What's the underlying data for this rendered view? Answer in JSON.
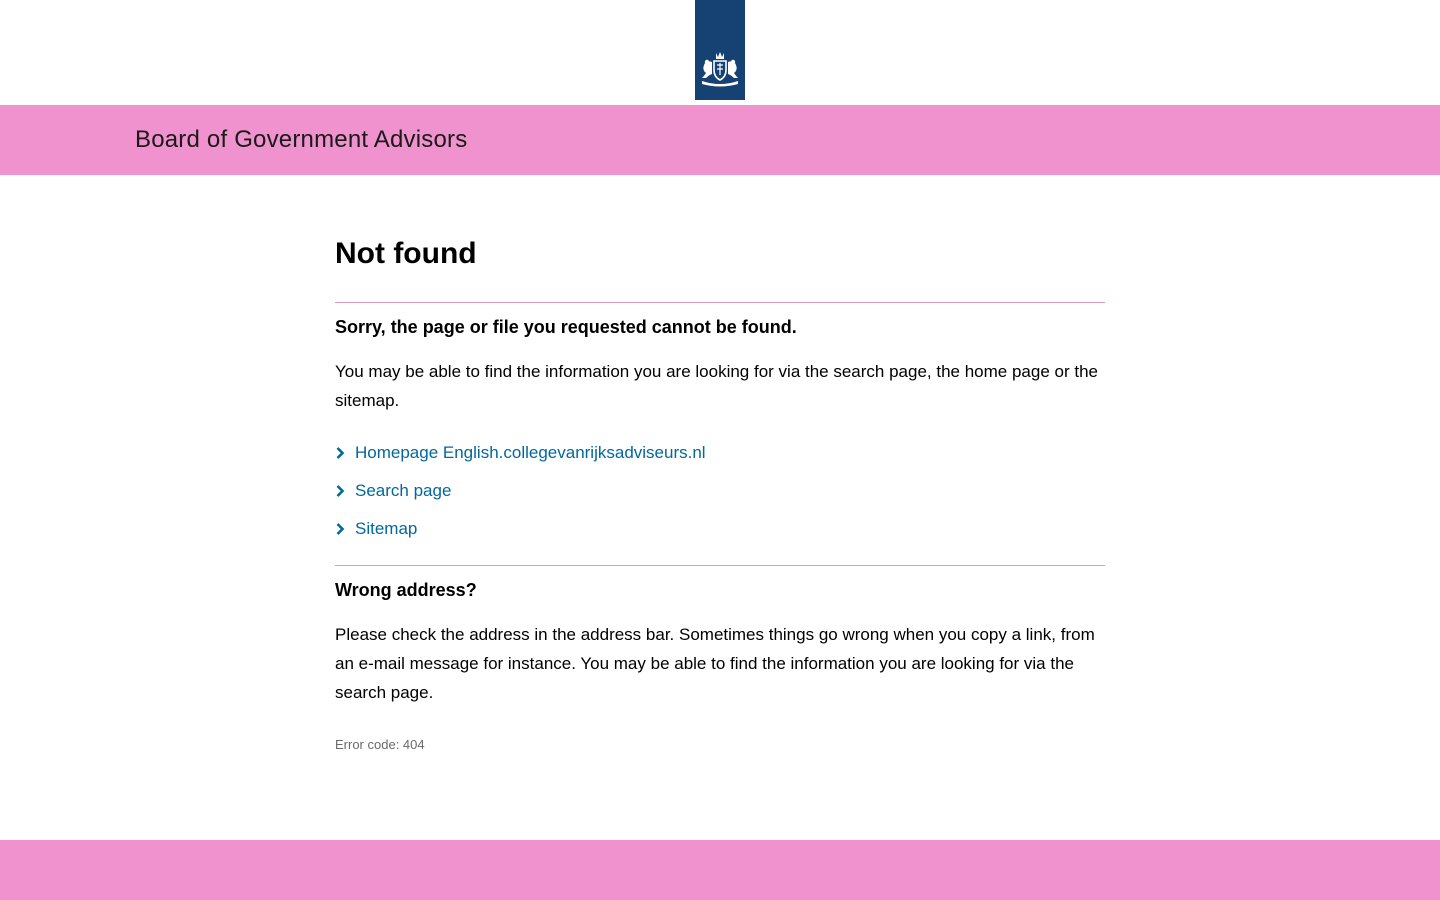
{
  "colors": {
    "brand_blue": "#154273",
    "banner_pink": "#f092cd",
    "link_blue": "#01689b",
    "divider_pink": "#d79fc4"
  },
  "header": {
    "logo_icon": "coat-of-arms-icon",
    "banner_title": "Board of Government Advisors"
  },
  "main": {
    "title": "Not found",
    "sorry_heading": "Sorry, the page or file you requested cannot be found.",
    "sorry_text": "You may be able to find the information you are looking for via the search page, the home page or the sitemap.",
    "links": [
      {
        "label": "Homepage English.collegevanrijksadviseurs.nl",
        "icon": "chevron-right-icon"
      },
      {
        "label": "Search page",
        "icon": "chevron-right-icon"
      },
      {
        "label": "Sitemap",
        "icon": "chevron-right-icon"
      }
    ],
    "wrong_heading": "Wrong address?",
    "wrong_text": "Please check the address in the address bar. Sometimes things go wrong when you copy a link, from an e-mail message for instance. You may be able to find the information you are looking for via the search page.",
    "error_code": "Error code: 404"
  }
}
